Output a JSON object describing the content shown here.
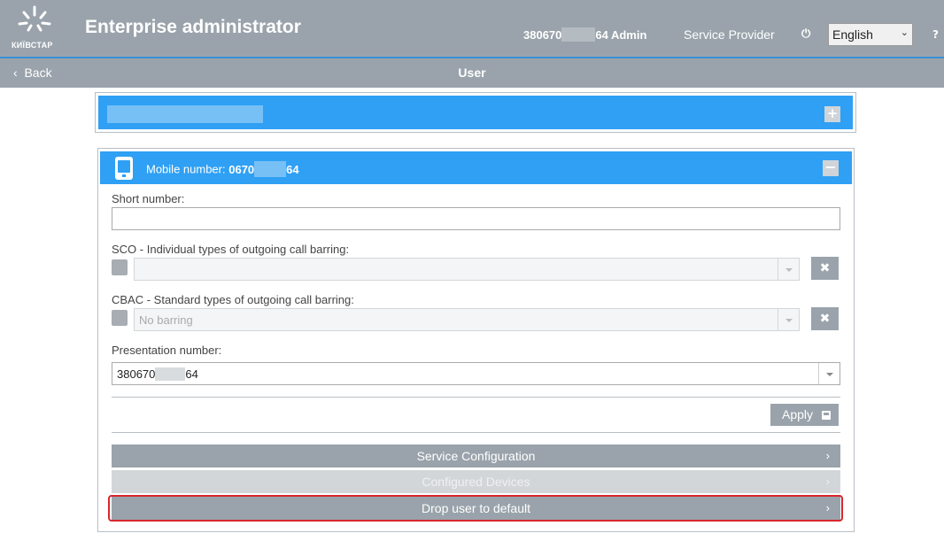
{
  "header": {
    "logo_text": "КИЇВСТАР",
    "title": "Enterprise administrator",
    "user_prefix": "380670",
    "user_suffix": "64 Admin",
    "role": "Service Provider",
    "power_glyph": "⏻",
    "language": "English",
    "help": "?"
  },
  "nav": {
    "back_label": "Back",
    "back_glyph": "‹",
    "title": "User"
  },
  "collapsed_panel": {
    "expand_glyph": "+"
  },
  "user_panel": {
    "mobile_label": "Mobile number:",
    "mobile_prefix": "0670",
    "mobile_suffix": "64",
    "collapse_glyph": "−",
    "short_number": {
      "label": "Short number:",
      "value": ""
    },
    "sco": {
      "label": "SCO - Individual types of outgoing call barring:",
      "value": "",
      "clear_glyph": "✖"
    },
    "cbac": {
      "label": "CBAC - Standard types of outgoing call barring:",
      "value": "No barring",
      "clear_glyph": "✖"
    },
    "presentation": {
      "label": "Presentation number:",
      "prefix": "380670",
      "suffix": "64"
    },
    "apply_label": "Apply",
    "rows": [
      {
        "label": "Service Configuration",
        "state": "active"
      },
      {
        "label": "Configured Devices",
        "state": "disabled"
      },
      {
        "label": "Drop user to default",
        "state": "highlighted"
      }
    ],
    "row_chevron": "›"
  },
  "colors": {
    "header_bg": "#9aa3ab",
    "accent_blue": "#2fa0f4",
    "highlight_red": "#d9262c"
  }
}
